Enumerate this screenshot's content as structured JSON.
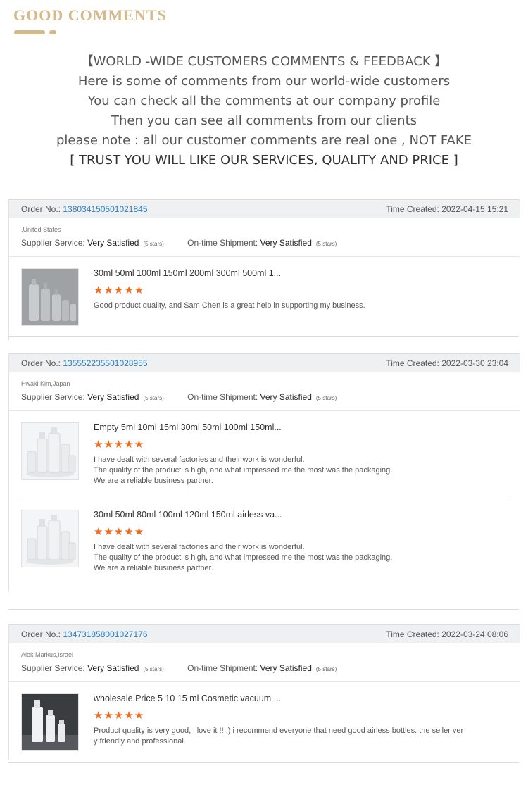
{
  "header": {
    "title": "GOOD COMMENTS"
  },
  "intro": {
    "lines": [
      "【WORLD -WIDE CUSTOMERS COMMENTS & FEEDBACK 】",
      "Here is some of comments from our world-wide customers",
      "You can check all the comments at our company profile",
      "Then you can see all comments from our clients",
      "please note : all our customer comments are real one , NOT FAKE",
      "[ TRUST YOU WILL LIKE OUR SERVICES, QUALITY AND PRICE ]"
    ]
  },
  "labels": {
    "order_no": "Order No.:",
    "time_created": "Time Created:",
    "supplier_service": "Supplier Service:",
    "on_time_shipment": "On-time Shipment:",
    "very_satisfied": "Very Satisfied",
    "five_stars": "(5 stars)",
    "star_glyphs": "★★★★★"
  },
  "reviews": [
    {
      "order_no": "138034150501021845",
      "time_created": "2022-04-15 15:21",
      "customer": ",United States",
      "items": [
        {
          "title": "30ml 50ml 100ml 150ml 200ml 300ml 500ml 1...",
          "rating": 5,
          "comment": [
            "Good product quality, and Sam Chen is a great help in supporting my business."
          ],
          "thumb": "aluminum-bottles"
        }
      ]
    },
    {
      "order_no": "135552235501028955",
      "time_created": "2022-03-30 23:04",
      "customer": "Hwaki Kim,Japan",
      "items": [
        {
          "title": "Empty 5ml 10ml 15ml 30ml 50ml 100ml 150ml...",
          "rating": 5,
          "comment": [
            "I have dealt with several factories and their work is wonderful.",
            "The quality of the product is high, and what impressed me the most was the packaging.",
            "We are a reliable business partner."
          ],
          "thumb": "white-bottles"
        },
        {
          "title": "30ml 50ml 80ml 100ml 120ml 150ml airless va...",
          "rating": 5,
          "comment": [
            "I have dealt with several factories and their work is wonderful.",
            "The quality of the product is high, and what impressed me the most was the packaging.",
            "We are a reliable business partner."
          ],
          "thumb": "white-bottles"
        }
      ]
    },
    {
      "order_no": "134731858001027176",
      "time_created": "2022-03-24 08:06",
      "customer": "Alek Markus,Israel",
      "items": [
        {
          "title": "wholesale Price 5 10 15 ml Cosmetic vacuum ...",
          "rating": 5,
          "comment": [
            "Product quality is very good, i love it !! :) i recommend everyone that need good airless bottles. the seller ver",
            "y friendly and professional."
          ],
          "thumb": "airless-dark"
        }
      ]
    }
  ]
}
